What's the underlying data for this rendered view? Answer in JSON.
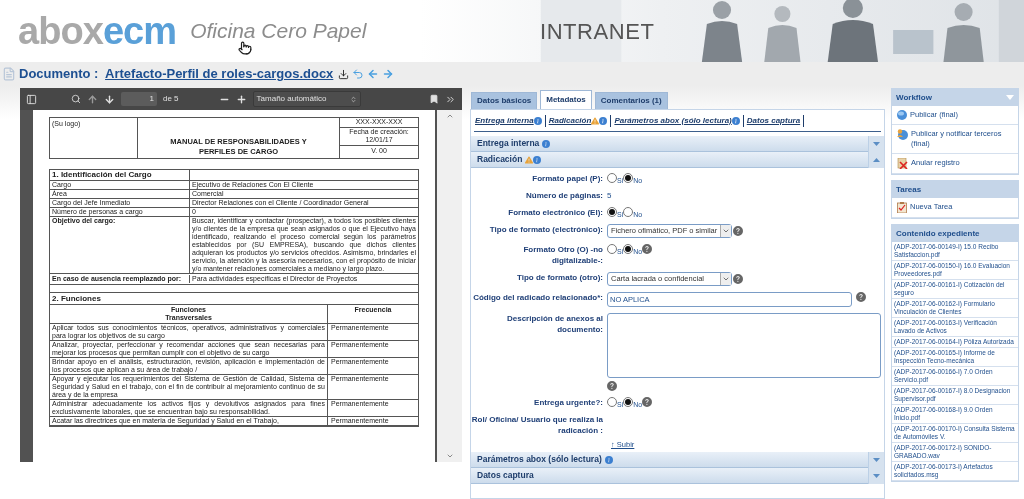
{
  "header": {
    "logo": {
      "part1": "abox",
      "part2": "ecm"
    },
    "tagline": "Oficina Cero Papel",
    "banner_title": "INTRANET"
  },
  "document_title": {
    "label": "Documento : ",
    "filename": "Artefacto-Perfil de roles-cargos.docx"
  },
  "pdf_viewer": {
    "page": "1",
    "page_total": "de 5",
    "zoom": "Tamaño automático",
    "document": {
      "logo_placeholder": "(Su logo)",
      "title": "MANUAL DE RESPONSABILIDADES Y PERFILES DE CARGO",
      "code": "XXX-XXX-XXX",
      "created_label": "Fecha de creación:",
      "created_date": "12/01/17",
      "version": "V. 00",
      "section_1": {
        "title": "1. Identificación del Cargo",
        "rows": [
          {
            "label": "Cargo",
            "value": "Ejecutivo de Relaciones Con El Cliente"
          },
          {
            "label": "Área",
            "value": "Comercial"
          },
          {
            "label": "Cargo del Jefe Inmediato",
            "value": "Director Relaciones con el Cliente / Coordinador General"
          },
          {
            "label": "Número de personas a cargo",
            "value": "0"
          },
          {
            "label": "Objetivo del cargo:",
            "value": "Buscar, identificar y contactar (prospectar), a todos los posibles clientes y/o clientes de la empresa que sean asignados o que el Ejecutivo haya identificado, realizando el proceso comercial según los parámetros establecidos por (SU EMPRESA), buscando que dichos clientes adquieran los productos y/o servicios ofrecidos. Asimismo, brindarles el servicio, la atención y la asesoría necesarios, con el propósito de iniciar y/o mantener relaciones comerciales a mediano y largo plazo."
          },
          {
            "label": "En caso de ausencia reemplazado por:",
            "value": "Para actividades específicas el Director de Proyectos"
          }
        ]
      },
      "section_2": {
        "title": "2. Funciones",
        "columns": [
          "Funciones Transversales",
          "Frecuencia"
        ],
        "rows": [
          {
            "function": "Aplicar todos sus conocimientos técnicos, operativos, administrativos y comerciales para lograr los objetivos de su cargo",
            "frequency": "Permanentemente"
          },
          {
            "function": "Analizar, proyectar, perfeccionar y recomendar acciones que sean necesarias para mejorar los procesos que permitan cumplir con el objetivo de su cargo",
            "frequency": "Permanentemente"
          },
          {
            "function": "Brindar apoyo en el análisis, estructuración, revisión, aplicación e implementación de los procesos que aplican a su área de trabajo /",
            "frequency": "Permanentemente"
          },
          {
            "function": "Apoyar y ejecutar los requerimientos del Sistema de Gestión de Calidad, Sistema de Seguridad y Salud en el trabajo, con el fin de contribuir al mejoramiento continuo de su área y de la empresa",
            "frequency": "Permanentemente"
          },
          {
            "function": "Administrar adecuadamente los activos fijos y devolutivos asignados para fines exclusivamente laborales, que se encuentran bajo su responsabilidad.",
            "frequency": "Permanentemente"
          },
          {
            "function": "Acatar las directrices que en materia de Seguridad y Salud en el Trabajo,",
            "frequency": "Permanentemente"
          }
        ]
      }
    }
  },
  "metadata_panel": {
    "tabs": [
      {
        "label": "Datos básicos",
        "selected": false
      },
      {
        "label": "Metadatos",
        "selected": true
      },
      {
        "label": "Comentarios (1)",
        "selected": false
      }
    ],
    "section_links": [
      {
        "label": "Entrega interna",
        "warning": false,
        "info": true
      },
      {
        "label": "Radicación",
        "warning": true,
        "info": true
      },
      {
        "label": "Parámetros abox (sólo lectura)",
        "warning": false,
        "info": true
      },
      {
        "label": "Datos captura",
        "warning": false,
        "info": false
      }
    ],
    "sections": [
      {
        "title": "Entrega interna",
        "expanded": false,
        "warning": false,
        "info": true
      },
      {
        "title": "Radicación",
        "expanded": true,
        "warning": true,
        "info": true,
        "back_to_top": "↑ Subir",
        "fields": [
          {
            "kind": "radio",
            "label": "Formato papel (P):",
            "help": false,
            "options": [
              {
                "label": "Si",
                "selected": false
              },
              {
                "label": "No",
                "selected": true
              }
            ]
          },
          {
            "kind": "static",
            "label": "Número de páginas:",
            "value": "5"
          },
          {
            "kind": "radio",
            "label": "Formato electrónico (El):",
            "help": false,
            "options": [
              {
                "label": "Si",
                "selected": true
              },
              {
                "label": "No",
                "selected": false
              }
            ]
          },
          {
            "kind": "select",
            "label": "Tipo de formato (electrónico):",
            "value": "Fichero ofimático, PDF o similar",
            "help": true
          },
          {
            "kind": "radio",
            "label": "Formato Otro (O) -no digitalizable-:",
            "help": true,
            "options": [
              {
                "label": "Si",
                "selected": false
              },
              {
                "label": "No",
                "selected": true
              }
            ]
          },
          {
            "kind": "select",
            "label": "Tipo de formato (otro):",
            "value": "Carta lacrada o confidencial",
            "help": true
          },
          {
            "kind": "input",
            "label": "Código del radicado relacionado*:",
            "value": "NO APLICA",
            "help": true
          },
          {
            "kind": "textarea",
            "label": "Descripción de anexos al documento:",
            "help": true
          },
          {
            "kind": "radio",
            "label": "Entrega urgente?:",
            "help": true,
            "options": [
              {
                "label": "Si",
                "selected": false
              },
              {
                "label": "No",
                "selected": true
              }
            ]
          },
          {
            "kind": "static",
            "label": "Rol/ Oficina/ Usuario que realiza la radicación :"
          }
        ]
      },
      {
        "title": "Parámetros abox (sólo lectura)",
        "expanded": false,
        "warning": false,
        "info": true
      },
      {
        "title": "Datos captura",
        "expanded": false,
        "warning": false,
        "info": false
      }
    ]
  },
  "sidebar": [
    {
      "title": "Workflow",
      "collapsible": true,
      "items": [
        {
          "kind": "publish",
          "label": "Publicar (final)"
        },
        {
          "kind": "publish_notify",
          "label": "Publicar y notificar terceros (final)"
        },
        {
          "kind": "cancel",
          "label": "Anular registro"
        }
      ]
    },
    {
      "title": "Tareas",
      "collapsible": false,
      "items": [
        {
          "kind": "task",
          "label": "Nueva Tarea"
        }
      ]
    },
    {
      "title": "Contenido expediente",
      "collapsible": false,
      "items": [
        {
          "kind": "file",
          "label": "(ADP-2017-06-00149-I) 15.0 Recibo Satisfaccion.pdf"
        },
        {
          "kind": "file",
          "label": "(ADP-2017-06-00150-I) 16.0 Evaluacion Proveedores.pdf"
        },
        {
          "kind": "file",
          "label": "(ADP-2017-06-00161-I) Cotización del seguro"
        },
        {
          "kind": "file",
          "label": "(ADP-2017-06-00162-I) Formulario Vinculación de Clientes"
        },
        {
          "kind": "file",
          "label": "(ADP-2017-06-00163-I) Verificación Lavado de Activos"
        },
        {
          "kind": "file",
          "label": "(ADP-2017-06-00164-I) Póliza Autorizada"
        },
        {
          "kind": "file",
          "label": "(ADP-2017-06-00165-I) Informe de Inspección Tecno-mecánica"
        },
        {
          "kind": "file",
          "label": "(ADP-2017-06-00166-I) 7.0 Orden Servicio.pdf"
        },
        {
          "kind": "file",
          "label": "(ADP-2017-06-00167-I) 8.0 Designacion Supervisor.pdf"
        },
        {
          "kind": "file",
          "label": "(ADP-2017-06-00168-I) 9.0 Orden Inicio.pdf"
        },
        {
          "kind": "file",
          "label": "(ADP-2017-06-00170-I) Consulta Sistema de Automóviles V."
        },
        {
          "kind": "file",
          "label": "(ADP-2017-06-00172-I) SONIDO-GRABADO.wav"
        },
        {
          "kind": "file",
          "label": "(ADP-2017-06-00173-I) Artefactos solicitados.msg"
        }
      ]
    }
  ]
}
